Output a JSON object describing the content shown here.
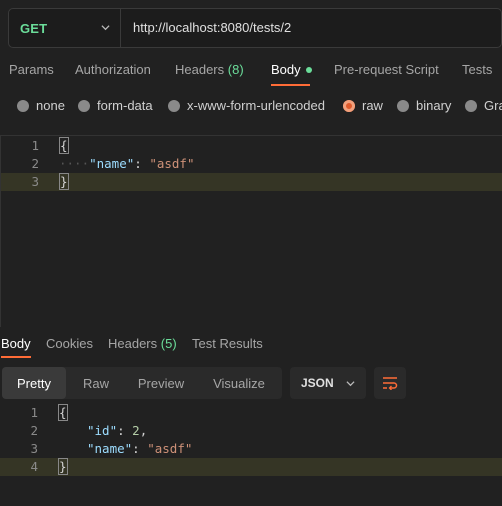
{
  "request": {
    "method": "GET",
    "url": "http://localhost:8080/tests/2",
    "tabs": [
      {
        "label": "Params"
      },
      {
        "label": "Authorization"
      },
      {
        "label": "Headers",
        "count": "(8)"
      },
      {
        "label": "Body",
        "active": true
      },
      {
        "label": "Pre-request Script"
      },
      {
        "label": "Tests"
      }
    ],
    "body_types": [
      "none",
      "form-data",
      "x-www-form-urlencoded",
      "raw",
      "binary",
      "Gra"
    ],
    "selected_body_type": "raw",
    "lines": [
      {
        "n": "1",
        "text": "{"
      },
      {
        "n": "2",
        "indent": "····",
        "key": "\"name\"",
        "sep": ": ",
        "value": "\"asdf\""
      },
      {
        "n": "3",
        "text": "}"
      }
    ]
  },
  "response": {
    "tabs": [
      {
        "label": "Body",
        "active": true
      },
      {
        "label": "Cookies"
      },
      {
        "label": "Headers",
        "count": "(5)"
      },
      {
        "label": "Test Results"
      }
    ],
    "view_modes": [
      "Pretty",
      "Raw",
      "Preview",
      "Visualize"
    ],
    "active_view": "Pretty",
    "format": "JSON",
    "lines": [
      {
        "n": "1",
        "text": "{"
      },
      {
        "n": "2",
        "key": "\"id\"",
        "sep": ": ",
        "value": "2",
        "trail": ","
      },
      {
        "n": "3",
        "key": "\"name\"",
        "sep": ": ",
        "value": "\"asdf\""
      },
      {
        "n": "4",
        "text": "}"
      }
    ]
  },
  "colors": {
    "accent": "#ff6c37",
    "method": "#6bdd9a",
    "count": "#6bdd9a",
    "json_key": "#9cdcfe",
    "json_string": "#ce9178"
  },
  "icons": [
    "chevron-down-icon",
    "radio-icon",
    "wrap-lines-icon"
  ]
}
